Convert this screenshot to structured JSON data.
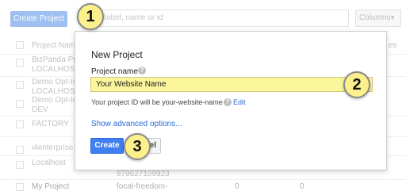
{
  "toolbar": {
    "create_project_label": "Create Project",
    "search_placeholder": "y label, name or id",
    "columns_label": "Columns"
  },
  "table": {
    "header_project_name": "Project Name",
    "header_right": "es",
    "rows": [
      {
        "line1": "BizPanda Pre",
        "line2": "LOCALHOST"
      },
      {
        "line1": "Demo Opt-In",
        "line2": "LOCALHOST"
      },
      {
        "line1": "Demo Opt-In",
        "line2": "DEV"
      },
      {
        "line1": "FACTORY",
        "line2": ""
      },
      {
        "line1": "i4enterprise",
        "line2": ""
      },
      {
        "line1": "Localhost",
        "line2": ""
      },
      {
        "line1": "My Project",
        "id_partial": "focal-freedom-",
        "number_partial": "879627109923",
        "val1": "0",
        "val2": "0"
      }
    ]
  },
  "dialog": {
    "title": "New Project",
    "project_name_label": "Project name",
    "project_name_value": "Your Website Name",
    "project_id_text": "Your project ID will be your-website-name",
    "edit_label": "Edit",
    "advanced_link": "Show advanced options...",
    "create_label": "Create",
    "cancel_partial": "el"
  },
  "callouts": {
    "one": "1",
    "two": "2",
    "three": "3"
  },
  "colors": {
    "callout_fill": "#fbf08c",
    "primary_button": "#3f7ff0",
    "input_highlight": "#fbf59c",
    "link": "#2a6bd6"
  }
}
